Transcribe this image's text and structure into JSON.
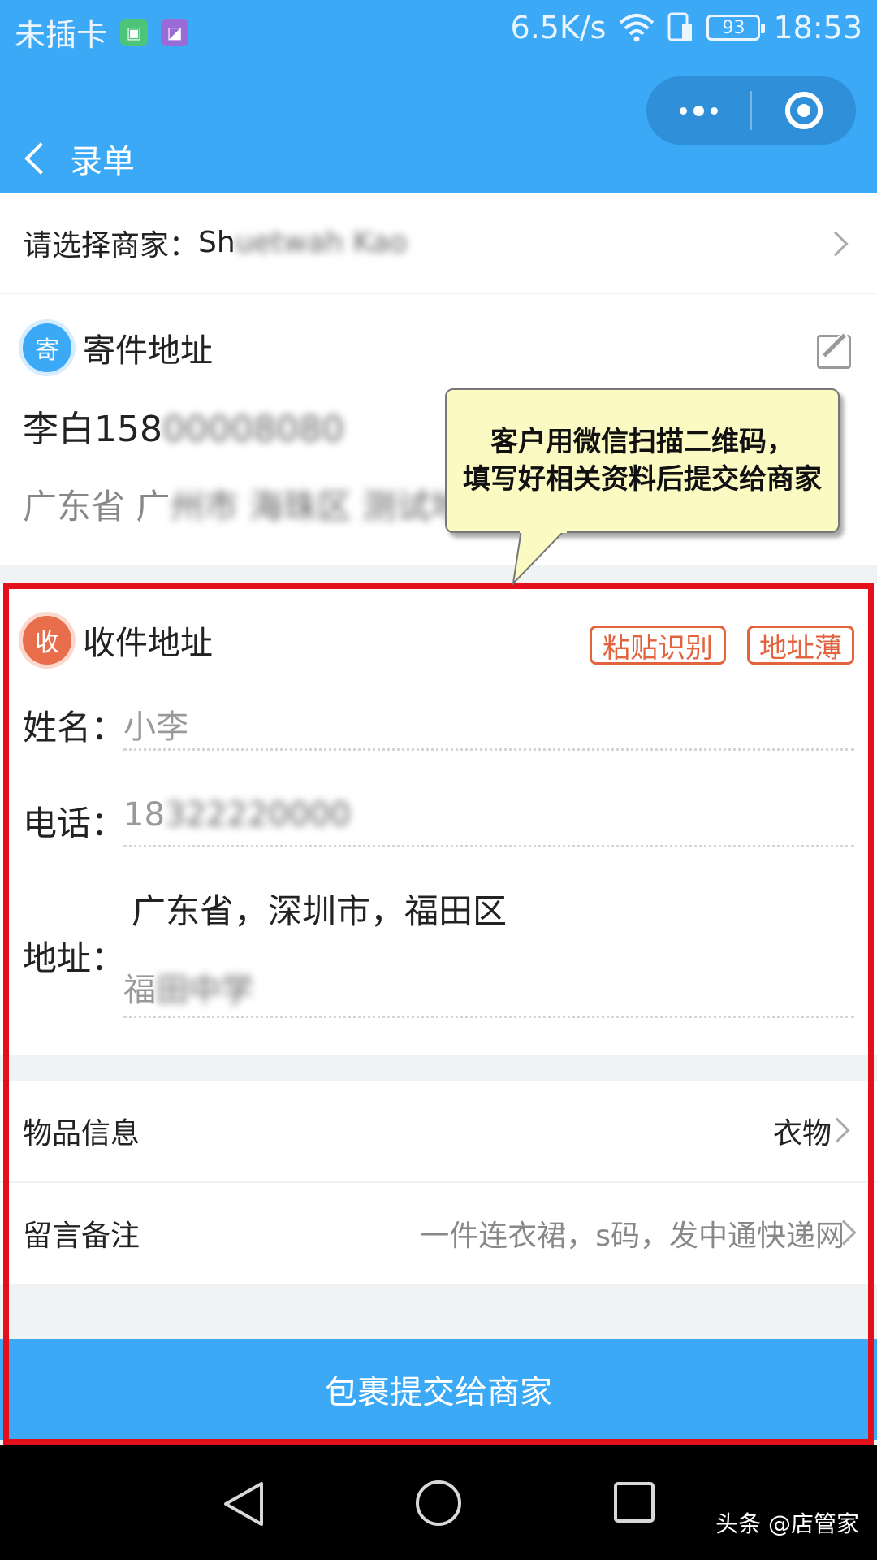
{
  "status_bar": {
    "carrier": "未插卡",
    "speed": "6.5K/s",
    "battery": "93",
    "time": "18:53"
  },
  "header": {
    "title": "录单"
  },
  "merchant": {
    "label": "请选择商家：",
    "value_visible": "Sh",
    "value_blurred": "uetwah Kao"
  },
  "sender": {
    "icon_char": "寄",
    "title": "寄件地址",
    "name_phone_visible": "李白158",
    "name_phone_blurred": "00008080",
    "address_visible": "广东省 广",
    "address_blurred": "州市 海珠区 测试地"
  },
  "callout": {
    "line1": "客户用微信扫描二维码，",
    "line2": "填写好相关资料后提交给商家"
  },
  "receiver": {
    "icon_char": "收",
    "title": "收件地址",
    "paste_button": "粘贴识别",
    "addressbook_button": "地址薄",
    "name_label": "姓名：",
    "name_value": "小李",
    "phone_label": "电话：",
    "phone_visible": "18",
    "phone_blurred": "322220000",
    "address_label": "地址：",
    "region": "广东省，深圳市，福田区",
    "detail_visible": "福",
    "detail_blurred": "田中学"
  },
  "goods": {
    "label": "物品信息",
    "value": "衣物"
  },
  "remark": {
    "label": "留言备注",
    "value": "一件连衣裙，s码，发中通快递网"
  },
  "submit": {
    "label": "包裹提交给商家"
  },
  "watermark": "头条 @店管家",
  "colors": {
    "primary": "#3ba9f6",
    "accent": "#e2643f",
    "highlight_frame": "#e3101b",
    "callout_bg": "#fbfac2"
  }
}
